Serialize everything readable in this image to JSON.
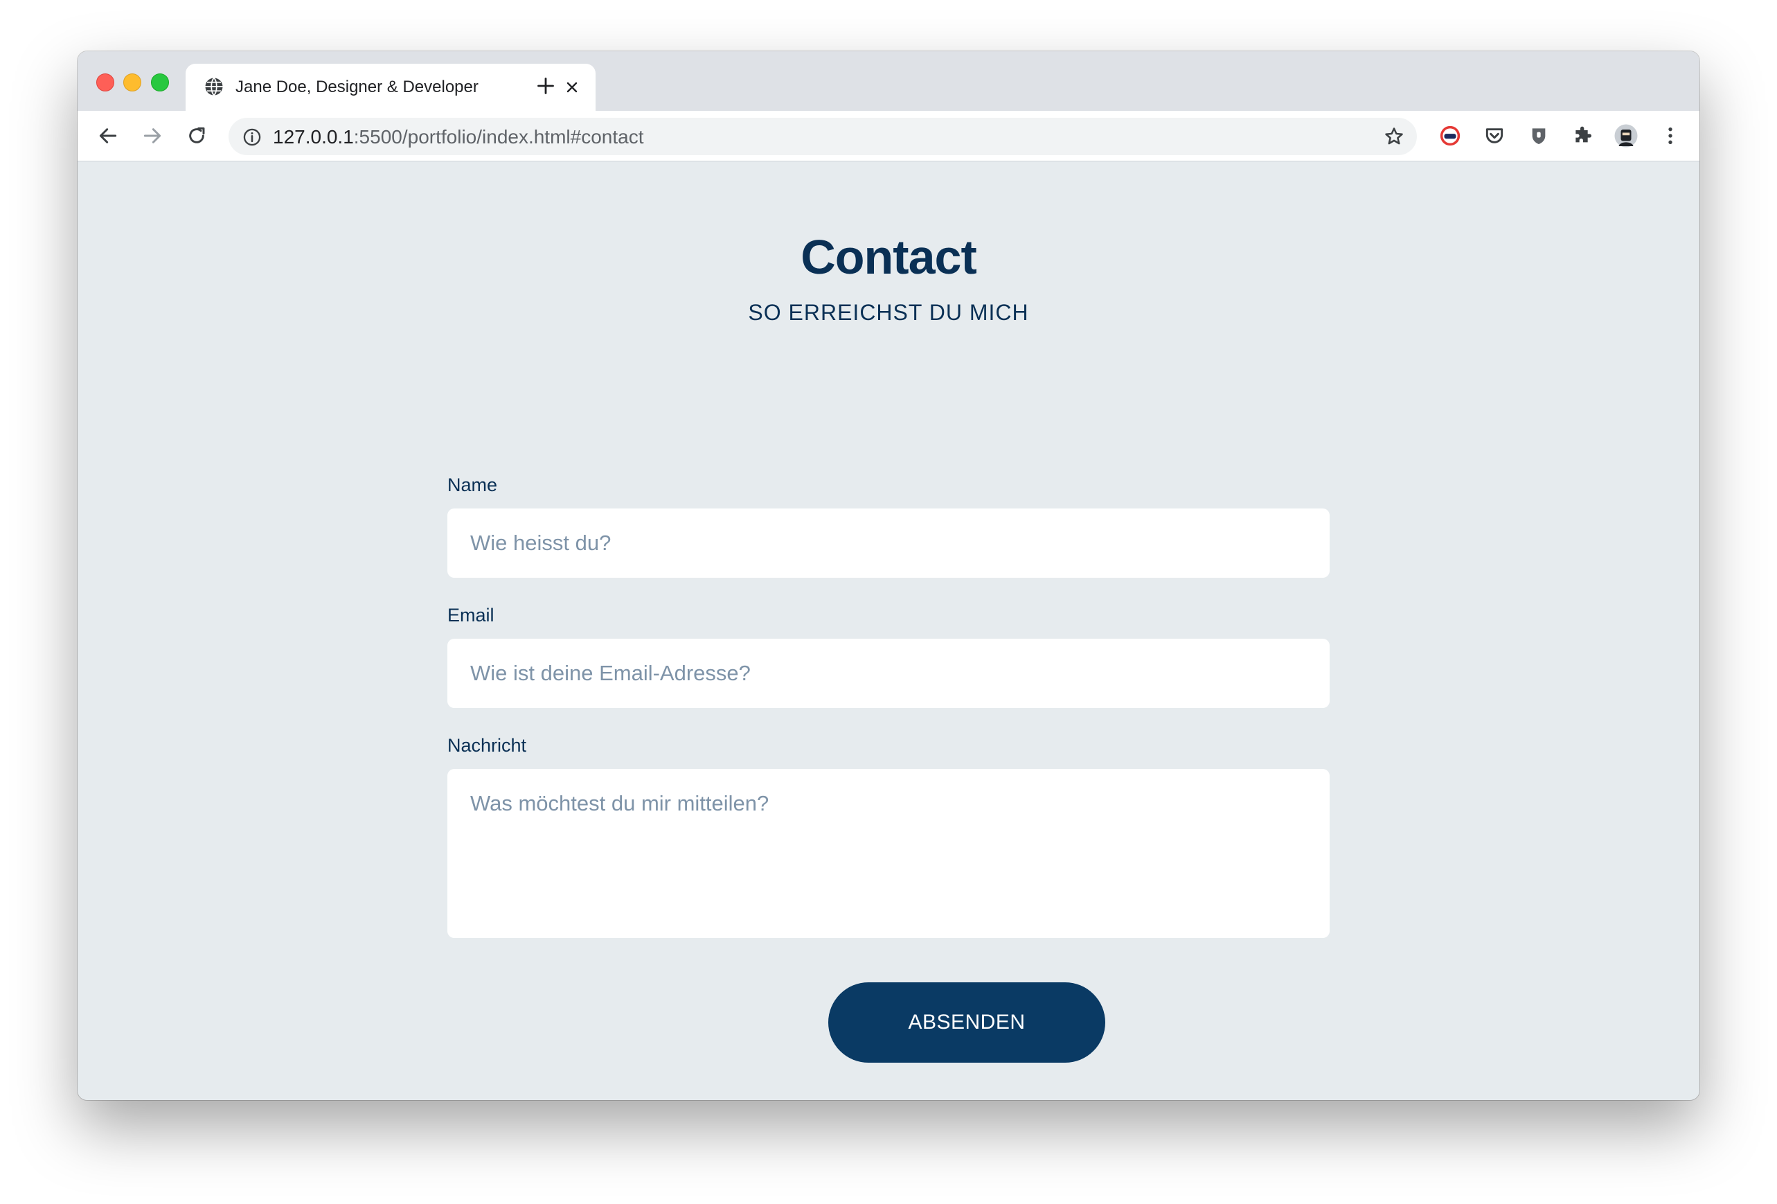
{
  "browser": {
    "tab": {
      "title": "Jane Doe, Designer & Developer",
      "favicon": "globe-icon",
      "close_icon": "close-icon"
    },
    "new_tab_icon": "plus-icon",
    "toolbar": {
      "back_icon": "arrow-left-icon",
      "forward_icon": "arrow-right-icon",
      "reload_icon": "reload-icon",
      "site_info_icon": "info-icon",
      "bookmark_icon": "star-icon",
      "extensions": [
        "extension-red-circle-icon",
        "pocket-icon",
        "shield-icon",
        "puzzle-icon"
      ],
      "profile_icon": "avatar",
      "menu_icon": "more-vert-icon"
    },
    "address_bar": {
      "host": "127.0.0.1",
      "path": ":5500/portfolio/index.html#contact"
    },
    "traffic_lights": {
      "close": "#fe5f57",
      "minimize": "#febc2e",
      "maximize": "#28c840"
    }
  },
  "contact": {
    "title": "Contact",
    "subtitle": "SO ERREICHST DU MICH",
    "fields": {
      "name": {
        "label": "Name",
        "placeholder": "Wie heisst du?",
        "value": ""
      },
      "email": {
        "label": "Email",
        "placeholder": "Wie ist deine Email-Adresse?",
        "value": ""
      },
      "message": {
        "label": "Nachricht",
        "placeholder": "Was möchtest du mir mitteilen?",
        "value": ""
      }
    },
    "submit_label": "ABSENDEN"
  },
  "colors": {
    "page_background": "#e6ebee",
    "primary": "#0a3055",
    "button": "#0a3a64",
    "placeholder": "#7e93a8"
  }
}
